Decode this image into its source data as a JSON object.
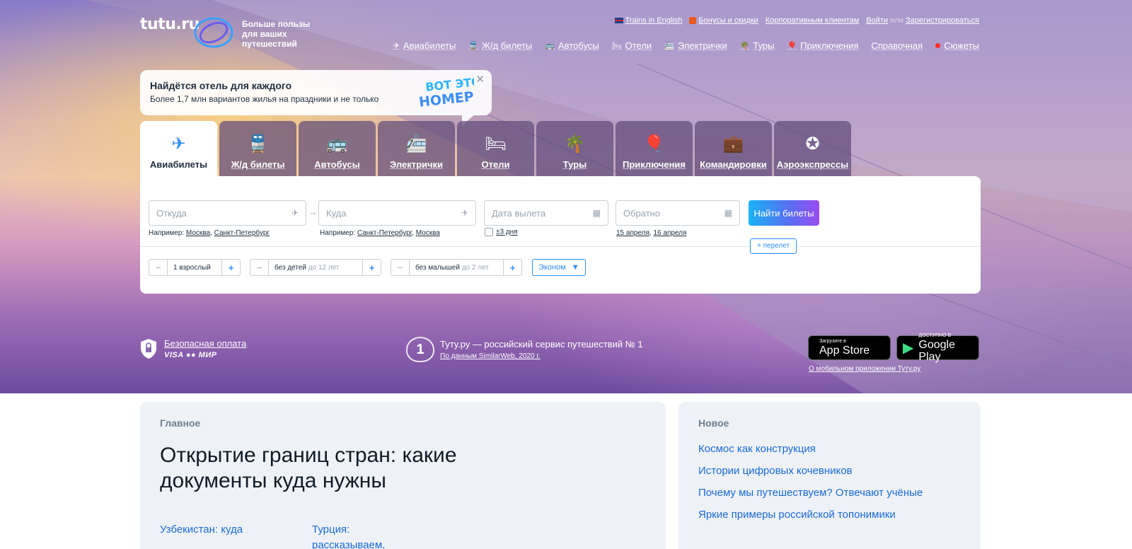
{
  "header": {
    "logo_text": "tutu.ru",
    "tagline": "Больше пользы для ваших путешествий",
    "util_links": [
      "Trains in English",
      "Бонусы и скидки",
      "Корпоративным клиентам"
    ],
    "login": "Войти",
    "or": "или",
    "register": "Зарегистрироваться",
    "nav": [
      {
        "label": "Авиабилеты",
        "icon": "plane-icon"
      },
      {
        "label": "Ж/д билеты",
        "icon": "train-icon"
      },
      {
        "label": "Автобусы",
        "icon": "bus-icon"
      },
      {
        "label": "Отели",
        "icon": "bed-icon"
      },
      {
        "label": "Электрички",
        "icon": "suburban-train-icon"
      },
      {
        "label": "Туры",
        "icon": "palm-icon"
      },
      {
        "label": "Приключения",
        "icon": "balloon-icon"
      },
      {
        "label": "Справочная",
        "icon": ""
      },
      {
        "label": "Сюжеты",
        "icon": "red-dot-icon"
      }
    ]
  },
  "promo": {
    "title": "Найдётся отель для каждого",
    "subtitle": "Более 1,7 млн вариантов жилья на праздники и не только",
    "badge_line1": "ВОТ ЭТО",
    "badge_line2": "НОМЕР!"
  },
  "tabs": [
    {
      "label": "Авиабилеты",
      "icon": "plane-icon",
      "active": true
    },
    {
      "label": "Ж/д билеты",
      "icon": "train-icon"
    },
    {
      "label": "Автобусы",
      "icon": "bus-icon"
    },
    {
      "label": "Электрички",
      "icon": "suburban-train-icon"
    },
    {
      "label": "Отели",
      "icon": "bed-icon"
    },
    {
      "label": "Туры",
      "icon": "palm-icon"
    },
    {
      "label": "Приключения",
      "icon": "balloon-icon"
    },
    {
      "label": "Командировки",
      "icon": "briefcase-icon"
    },
    {
      "label": "Аэроэкспрессы",
      "icon": "aeroexpress-icon"
    }
  ],
  "search": {
    "from_placeholder": "Откуда",
    "to_placeholder": "Куда",
    "date_placeholder": "Дата вылета",
    "return_placeholder": "Обратно",
    "find_button": "Найти билеты",
    "hint_prefix": "Например:",
    "from_hint_1": "Москва",
    "from_hint_2": "Санкт-Петербург",
    "to_hint_1": "Санкт-Петербург",
    "to_hint_2": "Москва",
    "flex_dates": "±3 дня",
    "return_hint_1": "15 апреля",
    "return_hint_2": "16 апреля",
    "add_flight": "+ перелет",
    "adults": "1 взрослый",
    "children": "без детей",
    "children_age": "до 12 лет",
    "infants": "без малышей",
    "infants_age": "до 2 лет",
    "class": "Эконом"
  },
  "trust": {
    "secure_title": "Безопасная оплата",
    "payments": "VISA ●● МИР",
    "award_num": "1",
    "award_title": "Туту.ру — российский сервис путешествий № 1",
    "award_source": "По данным SimilarWeb, 2020 г.",
    "appstore_small": "Загрузите в",
    "appstore_big": "App Store",
    "googleplay_small": "ДОСТУПНО В",
    "googleplay_big": "Google Play",
    "mobile_link": "О мобильном приложении Туту.ру"
  },
  "main_card": {
    "label": "Главное",
    "headline": "Открытие границ стран: какие документы куда нужны",
    "sub1": "Узбекистан: куда",
    "sub2": "Турция: рассказываем,"
  },
  "new_card": {
    "label": "Новое",
    "items": [
      "Космос как конструкция",
      "Истории цифровых кочевников",
      "Почему мы путешествуем? Отвечают учёные",
      "Яркие примеры российской топонимики"
    ]
  },
  "colors": {
    "accent": "#2b8cf5",
    "link": "#1a6ad6",
    "tab_inactive": "#5f4b78",
    "button_gradient_start": "#19b3f5",
    "button_gradient_end": "#9b4cf0"
  }
}
